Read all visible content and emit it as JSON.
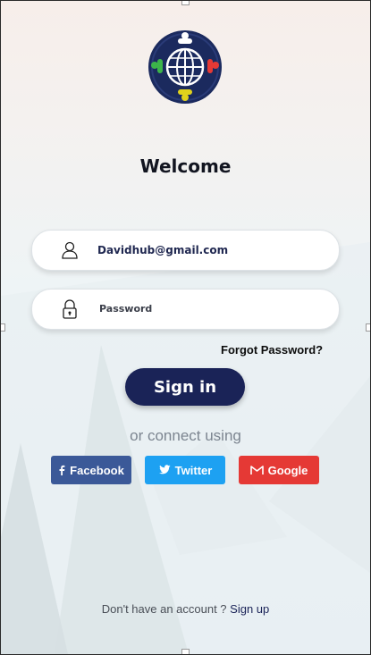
{
  "welcome": "Welcome",
  "email_field": {
    "value": "Davidhub@gmail.com",
    "icon": "user-icon"
  },
  "password_field": {
    "placeholder": "Password",
    "icon": "lock-icon"
  },
  "forgot_password": "Forgot Password?",
  "sign_in_button": "Sign in",
  "connect_text": "or connect using",
  "social": {
    "facebook": {
      "label": "Facebook",
      "icon": "facebook-icon",
      "color": "#3b5998"
    },
    "twitter": {
      "label": "Twitter",
      "icon": "twitter-icon",
      "color": "#1da1f2"
    },
    "google": {
      "label": "Google",
      "icon": "gmail-icon",
      "color": "#e53935"
    }
  },
  "signup": {
    "prompt": "Don't have an account ?",
    "link": "Sign up"
  },
  "colors": {
    "primary": "#1a2357",
    "logo_outer": "#1b2a5e"
  }
}
